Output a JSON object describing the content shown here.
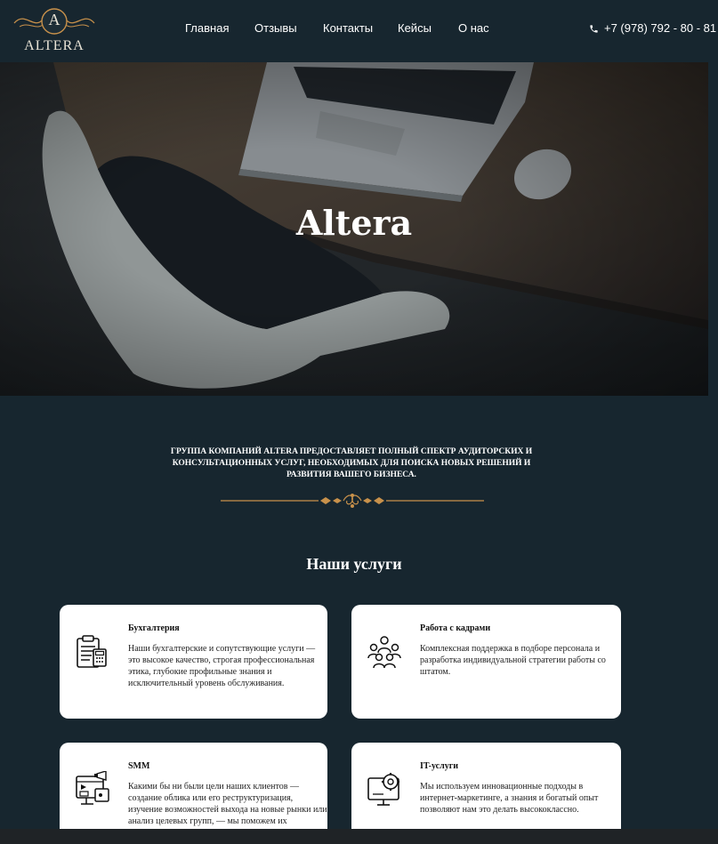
{
  "header": {
    "logo_letter": "A",
    "logo_text": "ALTERA",
    "nav": [
      "Главная",
      "Отзывы",
      "Контакты",
      "Кейсы",
      "О нас"
    ],
    "phone": "+7 (978) 792 - 80 - 81"
  },
  "hero": {
    "title": "Altera"
  },
  "intro": {
    "text": "ГРУППА КОМПАНИЙ ALTERA ПРЕДОСТАВЛЯЕТ ПОЛНЫЙ СПЕКТР АУДИТОРСКИХ И КОНСУЛЬТАЦИОННЫХ УСЛУГ, НЕОБХОДИМЫХ ДЛЯ ПОИСКА НОВЫХ РЕШЕНИЙ И РАЗВИТИЯ ВАШЕГО БИЗНЕСА."
  },
  "services": {
    "title": "Наши услуги",
    "items": [
      {
        "icon": "accounting-clipboard-icon",
        "title": "Бухгалтерия",
        "text": "Наши бухгалтерские и сопутствующие услуги — это высокое качество, строгая профессиональная этика, глубокие профильные знания и исключительный уровень обслуживания."
      },
      {
        "icon": "team-people-icon",
        "title": "Работа с кадрами",
        "text": "Комплексная поддержка в подборе персонала и разработка индивидуальной стратегии работы со штатом."
      },
      {
        "icon": "smm-media-icon",
        "title": "SMM",
        "text": "Какими бы ни были цели наших клиентов — создание облика или его реструктуризация, изучение возможностей выхода на новые рынки или анализ целевых групп, — мы поможем их"
      },
      {
        "icon": "monitor-gear-icon",
        "title": "IT-услуги",
        "text": "Мы используем инновационные подходы в интернет-маркетинге, а знания и богатый опыт позволяют нам это делать высококлассно."
      }
    ]
  },
  "colors": {
    "background": "#17262f",
    "accent_gold": "#c8914b",
    "card": "#ffffff"
  }
}
